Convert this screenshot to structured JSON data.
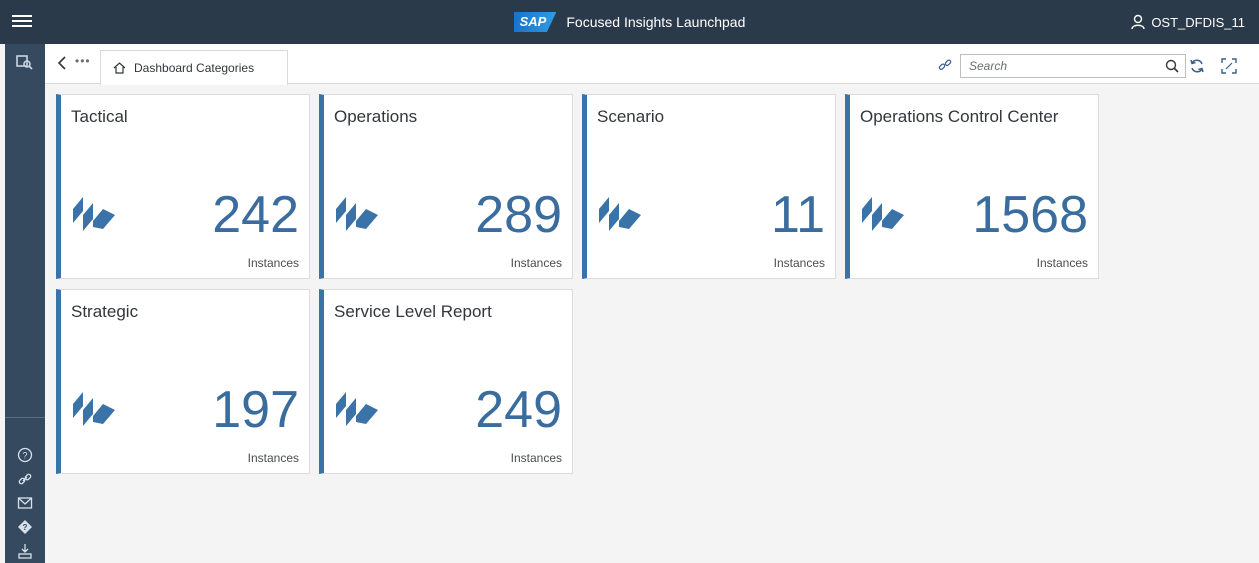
{
  "shell": {
    "brand": "SAP",
    "title": "Focused Insights Launchpad",
    "user": "OST_DFDIS_11"
  },
  "toolbar": {
    "more": "•••",
    "tab_label": "Dashboard Categories",
    "search_placeholder": "Search"
  },
  "tiles": [
    {
      "title": "Tactical",
      "count": "242",
      "unit": "Instances"
    },
    {
      "title": "Operations",
      "count": "289",
      "unit": "Instances"
    },
    {
      "title": "Scenario",
      "count": "11",
      "unit": "Instances"
    },
    {
      "title": "Operations Control Center",
      "count": "1568",
      "unit": "Instances"
    },
    {
      "title": "Strategic",
      "count": "197",
      "unit": "Instances"
    },
    {
      "title": "Service Level Report",
      "count": "249",
      "unit": "Instances"
    }
  ],
  "colors": {
    "shell": "#2b3a4a",
    "sidebar": "#354a5f",
    "accent": "#3a73a8"
  },
  "icons": [
    "menu-icon",
    "user-icon",
    "back-icon",
    "home-icon",
    "link-icon",
    "search-icon",
    "refresh-icon",
    "fullscreen-icon",
    "help-icon",
    "mail-icon",
    "download-icon",
    "category-icon"
  ]
}
